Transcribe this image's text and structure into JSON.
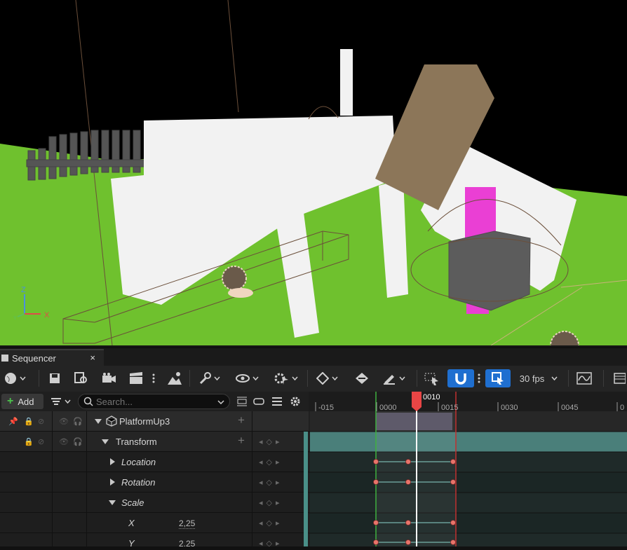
{
  "viewport": {
    "axis_labels": {
      "z": "Z",
      "x": "X",
      "y": "Y"
    }
  },
  "sequencer_tab": {
    "title": "Sequencer",
    "close_glyph": "×"
  },
  "toolbar": {
    "fps_label": "30 fps",
    "icons": [
      "world-icon",
      "save-icon",
      "find-asset-icon",
      "camera-icon",
      "clapper-icon",
      "more-icon",
      "render-icon",
      "wrench-icon",
      "eye-icon",
      "gear-snap-icon",
      "key-diamond-icon",
      "key-swap-icon",
      "pen-icon",
      "select-icon",
      "magnet-icon",
      "more-icon",
      "snap-frame-icon",
      "curve-editor-icon",
      "timeline-icon"
    ],
    "accent": "#1f6fd0"
  },
  "filterbar": {
    "add_label": "Add",
    "search_placeholder": "Search..."
  },
  "tracks": [
    {
      "label": "PlatformUp3",
      "expanded": true,
      "level": 0
    },
    {
      "label": "Transform",
      "expanded": true,
      "level": 1
    },
    {
      "label": "Location",
      "expanded": false,
      "level": 2
    },
    {
      "label": "Rotation",
      "expanded": false,
      "level": 2
    },
    {
      "label": "Scale",
      "expanded": true,
      "level": 2
    },
    {
      "label": "X",
      "value": "2,25",
      "level": 3
    },
    {
      "label": "Y",
      "value": "2,25",
      "level": 3
    }
  ],
  "timeline": {
    "current_frame": "0010",
    "ticks": [
      "-015",
      "0000",
      "0015",
      "0030",
      "0045",
      "0"
    ],
    "colors": {
      "playhead": "#e84545",
      "key": "#e8746a",
      "track": "#4a7f7a",
      "section": "#5e5a6a"
    }
  }
}
